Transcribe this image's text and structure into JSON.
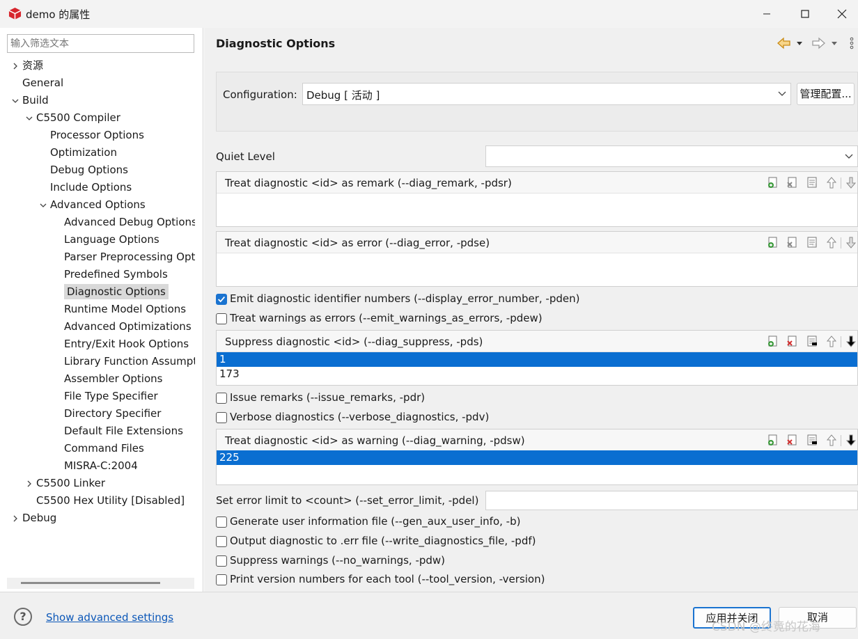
{
  "window": {
    "title": "demo 的属性"
  },
  "filter": {
    "placeholder": "输入筛选文本"
  },
  "tree": [
    {
      "label": "资源",
      "level": 0,
      "toggle": "collapsed"
    },
    {
      "label": "General",
      "level": 0,
      "toggle": "none"
    },
    {
      "label": "Build",
      "level": 0,
      "toggle": "expanded"
    },
    {
      "label": "C5500 Compiler",
      "level": 1,
      "toggle": "expanded"
    },
    {
      "label": "Processor Options",
      "level": 2,
      "toggle": "none"
    },
    {
      "label": "Optimization",
      "level": 2,
      "toggle": "none"
    },
    {
      "label": "Debug Options",
      "level": 2,
      "toggle": "none"
    },
    {
      "label": "Include Options",
      "level": 2,
      "toggle": "none"
    },
    {
      "label": "Advanced Options",
      "level": 2,
      "toggle": "expanded"
    },
    {
      "label": "Advanced Debug Options",
      "level": 3,
      "toggle": "none"
    },
    {
      "label": "Language Options",
      "level": 3,
      "toggle": "none"
    },
    {
      "label": "Parser Preprocessing Options",
      "level": 3,
      "toggle": "none"
    },
    {
      "label": "Predefined Symbols",
      "level": 3,
      "toggle": "none"
    },
    {
      "label": "Diagnostic Options",
      "level": 3,
      "toggle": "none",
      "selected": true
    },
    {
      "label": "Runtime Model Options",
      "level": 3,
      "toggle": "none"
    },
    {
      "label": "Advanced Optimizations",
      "level": 3,
      "toggle": "none"
    },
    {
      "label": "Entry/Exit Hook Options",
      "level": 3,
      "toggle": "none"
    },
    {
      "label": "Library Function Assumptions",
      "level": 3,
      "toggle": "none"
    },
    {
      "label": "Assembler Options",
      "level": 3,
      "toggle": "none"
    },
    {
      "label": "File Type Specifier",
      "level": 3,
      "toggle": "none"
    },
    {
      "label": "Directory Specifier",
      "level": 3,
      "toggle": "none"
    },
    {
      "label": "Default File Extensions",
      "level": 3,
      "toggle": "none"
    },
    {
      "label": "Command Files",
      "level": 3,
      "toggle": "none"
    },
    {
      "label": "MISRA-C:2004",
      "level": 3,
      "toggle": "none"
    },
    {
      "label": "C5500 Linker",
      "level": 1,
      "toggle": "collapsed"
    },
    {
      "label": "C5500 Hex Utility  [Disabled]",
      "level": 1,
      "toggle": "none"
    },
    {
      "label": "Debug",
      "level": 0,
      "toggle": "collapsed"
    }
  ],
  "page": {
    "title": "Diagnostic Options"
  },
  "config": {
    "label": "Configuration:",
    "value": "Debug  [ 活动 ]",
    "manage_button": "管理配置..."
  },
  "quiet_level": {
    "label": "Quiet Level",
    "value": ""
  },
  "lists": {
    "remark": {
      "title": "Treat diagnostic <id> as remark (--diag_remark, -pdsr)",
      "items": []
    },
    "error": {
      "title": "Treat diagnostic <id> as error (--diag_error, -pdse)",
      "items": []
    },
    "suppress": {
      "title": "Suppress diagnostic <id> (--diag_suppress, -pds)",
      "items": [
        "1",
        "173"
      ],
      "selected": 0
    },
    "warning": {
      "title": "Treat diagnostic <id> as warning (--diag_warning, -pdsw)",
      "items": [
        "225"
      ],
      "selected": 0
    }
  },
  "checks": {
    "emit_ids": {
      "label": "Emit diagnostic identifier numbers (--display_error_number, -pden)",
      "checked": true
    },
    "warn_as_err": {
      "label": "Treat warnings as errors (--emit_warnings_as_errors, -pdew)",
      "checked": false
    },
    "issue_remarks": {
      "label": "Issue remarks (--issue_remarks, -pdr)",
      "checked": false
    },
    "verbose": {
      "label": "Verbose diagnostics (--verbose_diagnostics, -pdv)",
      "checked": false
    },
    "gen_aux": {
      "label": "Generate user information file (--gen_aux_user_info, -b)",
      "checked": false
    },
    "write_diag": {
      "label": "Output diagnostic to .err file (--write_diagnostics_file, -pdf)",
      "checked": false
    },
    "no_warn": {
      "label": "Suppress warnings (--no_warnings, -pdw)",
      "checked": false
    },
    "tool_ver": {
      "label": "Print version numbers for each tool (--tool_version, -version)",
      "checked": false
    }
  },
  "error_limit": {
    "label": "Set error limit to <count> (--set_error_limit, -pdel)",
    "value": ""
  },
  "footer": {
    "help": "?",
    "advanced_link": "Show advanced settings",
    "apply_close": "应用并关闭",
    "cancel": "取消"
  },
  "watermark": "CSDN @终竟的花海",
  "colors": {
    "selection": "#0a6ed1",
    "checkbox": "#1a73d0",
    "link": "#0b57b8",
    "add_icon": "#3c9a3c",
    "remove_icon": "#d32f2f"
  }
}
